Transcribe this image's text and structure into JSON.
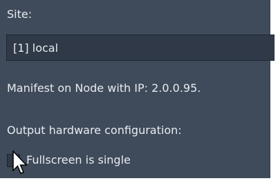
{
  "site": {
    "label": "Site:",
    "selected_value": "[1] local"
  },
  "manifest": {
    "text": "Manifest on Node with IP: 2.0.0.95."
  },
  "output": {
    "label": "Output hardware configuration:",
    "fullscreen_checkbox": {
      "label": "Fullscreen is single",
      "checked": false
    }
  },
  "icons": {
    "cursor": "mouse-pointer-arrow-icon"
  },
  "colors": {
    "panel_background": "#3f4a5a",
    "field_background": "#2f3947",
    "text": "#e8ecf2"
  }
}
